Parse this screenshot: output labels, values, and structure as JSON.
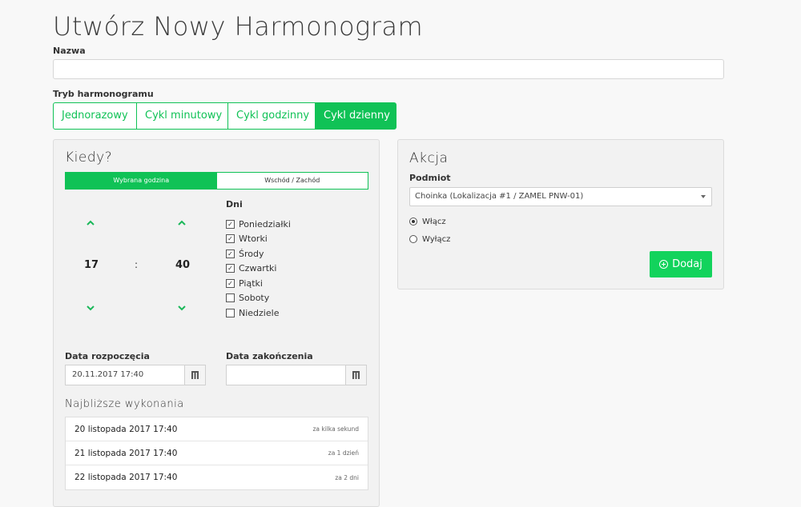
{
  "page": {
    "title": "Utwórz Nowy Harmonogram"
  },
  "form": {
    "name_label": "Nazwa",
    "name_value": "",
    "mode_label": "Tryb harmonogramu",
    "modes": [
      "Jednorazowy",
      "Cykl minutowy",
      "Cykl godzinny",
      "Cykl dzienny"
    ],
    "active_mode": "Cykl dzienny"
  },
  "when": {
    "title": "Kiedy?",
    "tabs": [
      "Wybrana godzina",
      "Wschód / Zachód"
    ],
    "hour": "17",
    "separator": ":",
    "minute": "40",
    "days_label": "Dni",
    "days": [
      {
        "label": "Poniedziałki",
        "checked": true
      },
      {
        "label": "Wtorki",
        "checked": true
      },
      {
        "label": "Środy",
        "checked": true
      },
      {
        "label": "Czwartki",
        "checked": true
      },
      {
        "label": "Piątki",
        "checked": true
      },
      {
        "label": "Soboty",
        "checked": false
      },
      {
        "label": "Niedziele",
        "checked": false
      }
    ],
    "start_label": "Data rozpoczęcia",
    "start_value": "20.11.2017 17:40",
    "end_label": "Data zakończenia",
    "end_value": "",
    "next_title": "Najbliższe wykonania",
    "next_runs": [
      {
        "date": "20 listopada 2017 17:40",
        "relative": "za kilka sekund"
      },
      {
        "date": "21 listopada 2017 17:40",
        "relative": "za 1 dzień"
      },
      {
        "date": "22 listopada 2017 17:40",
        "relative": "za 2 dni"
      }
    ]
  },
  "action": {
    "title": "Akcja",
    "subject_label": "Podmiot",
    "subject_value": "Choinka (Lokalizacja #1 / ZAMEL PNW-01)",
    "options": [
      {
        "label": "Włącz",
        "selected": true
      },
      {
        "label": "Wyłącz",
        "selected": false
      }
    ],
    "add_label": "Dodaj"
  },
  "colors": {
    "accent": "#10c256"
  },
  "icons": {
    "up": "chevron-up-icon",
    "down": "chevron-down-icon",
    "calendar": "calendar-icon",
    "add": "plus-circle-icon"
  }
}
